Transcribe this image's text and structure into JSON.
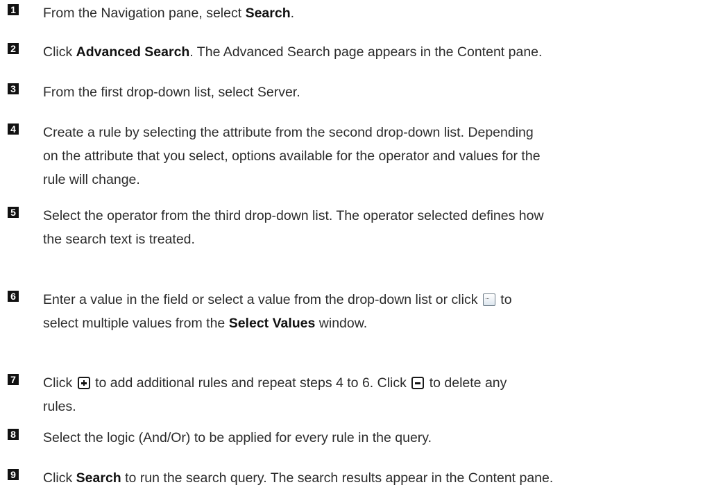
{
  "steps": [
    {
      "num": "1",
      "parts": [
        {
          "t": "From the Navigation pane, select "
        },
        {
          "b": "Search"
        },
        {
          "t": "."
        }
      ]
    },
    {
      "num": "2",
      "parts": [
        {
          "t": "Click "
        },
        {
          "b": "Advanced Search"
        },
        {
          "t": ". The Advanced Search page appears in the Content pane."
        }
      ]
    },
    {
      "num": "3",
      "parts": [
        {
          "t": "From the first drop-down list, select Server."
        }
      ]
    },
    {
      "num": "4",
      "lines": [
        [
          {
            "t": "Create a rule by selecting the attribute from the second drop-down list. Depending"
          }
        ],
        [
          {
            "t": "on the attribute that you select, options available for the operator and values for the"
          }
        ],
        [
          {
            "t": "rule will change."
          }
        ]
      ]
    },
    {
      "num": "5",
      "lines": [
        [
          {
            "t": "Select the operator from the third drop-down list. The operator selected defines how"
          }
        ],
        [
          {
            "t": "the search text is treated."
          }
        ]
      ]
    },
    {
      "num": "6",
      "lines": [
        [
          {
            "t": "Enter a value in the field or select a value from the drop-down list or click "
          },
          {
            "icon": "browse-values-icon"
          },
          {
            "t": " to"
          }
        ],
        [
          {
            "t": "select multiple values from the "
          },
          {
            "b": "Select Values"
          },
          {
            "t": " window."
          }
        ]
      ]
    },
    {
      "num": "7",
      "lines": [
        [
          {
            "t": "Click "
          },
          {
            "icon": "add-rule-icon"
          },
          {
            "t": " to add additional rules and repeat steps 4 to 6. Click "
          },
          {
            "icon": "delete-rule-icon"
          },
          {
            "t": " to delete any"
          }
        ],
        [
          {
            "t": "rules."
          }
        ]
      ]
    },
    {
      "num": "8",
      "parts": [
        {
          "t": "Select the logic (And/Or) to be applied for every rule in the query."
        }
      ]
    },
    {
      "num": "9",
      "parts": [
        {
          "t": "Click "
        },
        {
          "b": "Search"
        },
        {
          "t": " to run the search query. The search results appear in the Content pane."
        }
      ]
    }
  ]
}
